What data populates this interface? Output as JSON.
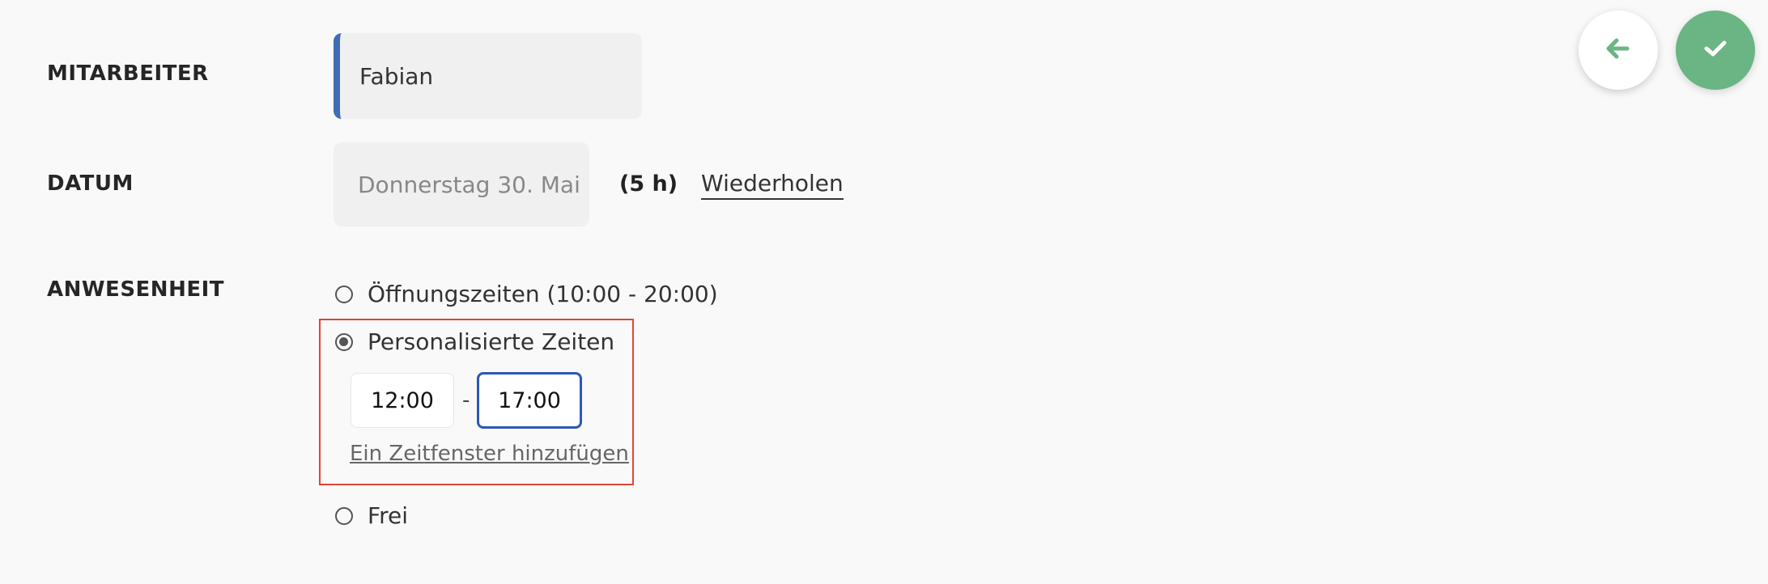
{
  "employee": {
    "label": "MITARBEITER",
    "value": "Fabian",
    "accent_color": "#3f6db3"
  },
  "date": {
    "label": "DATUM",
    "value": "Donnerstag 30. Mai",
    "hours": "(5 h)",
    "repeat_link": "Wiederholen"
  },
  "attendance": {
    "label": "ANWESENHEIT",
    "options": [
      {
        "label": "Öffnungszeiten (10:00 - 20:00)",
        "checked": false
      },
      {
        "label": "Personalisierte Zeiten",
        "checked": true
      },
      {
        "label": "Frei",
        "checked": false
      }
    ],
    "time_start": "12:00",
    "time_separator": "-",
    "time_end": "17:00",
    "add_window_link": "Ein Zeitfenster hinzufügen",
    "highlight_color": "#e04535"
  },
  "actions": {
    "back_icon": "arrow-left-icon",
    "confirm_icon": "check-icon",
    "confirm_color": "#6ab583",
    "icon_color": "#6ab583"
  }
}
